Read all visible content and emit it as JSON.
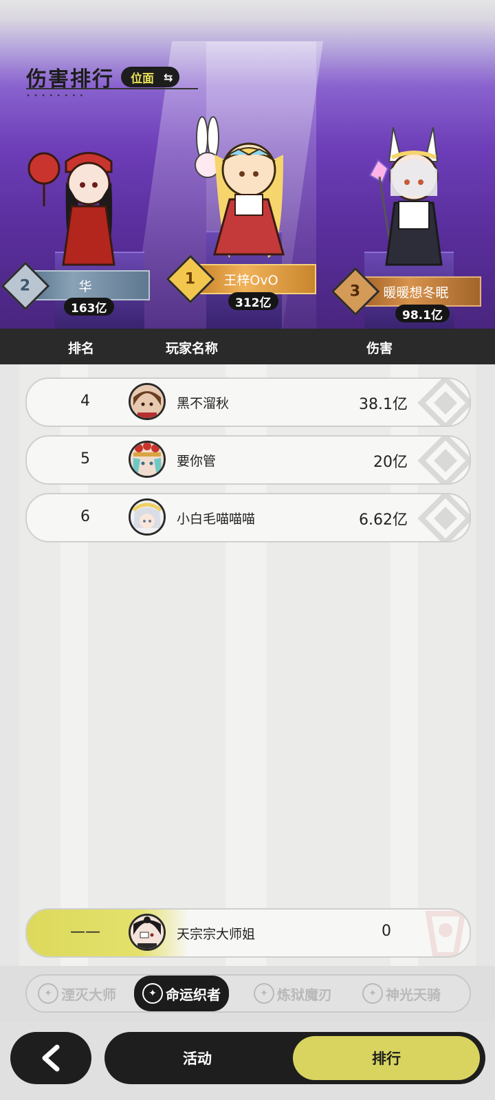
{
  "header": {
    "title": "伤害排行",
    "view_toggle_label": "位面",
    "view_toggle_icon": "swap-icon"
  },
  "podium": [
    {
      "rank": "1",
      "name": "王梓OvO",
      "score": "312亿"
    },
    {
      "rank": "2",
      "name": "华",
      "score": "163亿"
    },
    {
      "rank": "3",
      "name": "暖暖想冬眠",
      "score": "98.1亿"
    }
  ],
  "table_header": {
    "rank": "排名",
    "player": "玩家名称",
    "damage": "伤害"
  },
  "rows": [
    {
      "rank": "4",
      "name": "黑不溜秋",
      "damage": "38.1亿"
    },
    {
      "rank": "5",
      "name": "要你管",
      "damage": "20亿"
    },
    {
      "rank": "6",
      "name": "小白毛喵喵喵",
      "damage": "6.62亿"
    }
  ],
  "self_row": {
    "rank": "——",
    "name": "天宗宗大师姐",
    "damage": "0"
  },
  "class_tabs": [
    {
      "label": "湮灭大师",
      "active": false
    },
    {
      "label": "命运织者",
      "active": true
    },
    {
      "label": "炼狱魔刃",
      "active": false
    },
    {
      "label": "神光天骑",
      "active": false
    }
  ],
  "bottom_nav": {
    "back_icon": "chevron-left-icon",
    "activity": "活动",
    "ranking": "排行"
  },
  "colors": {
    "accent": "#d8d45f",
    "dark": "#1e1e1e",
    "hero_purple": "#6d3eb8"
  }
}
